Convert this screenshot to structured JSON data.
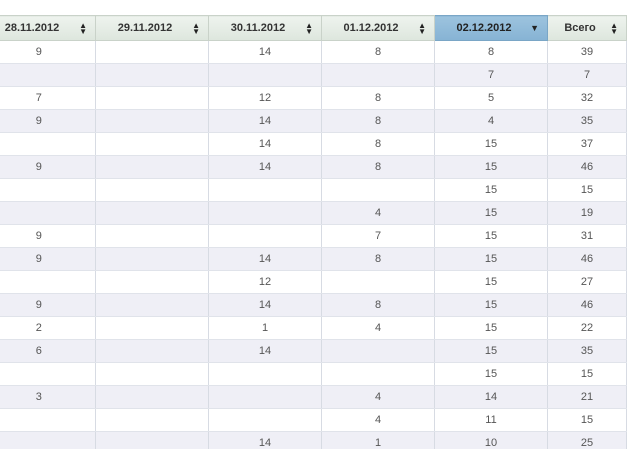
{
  "columns": [
    {
      "label": "28.11.2012",
      "sort_icon": "sort-both-icon",
      "active": false
    },
    {
      "label": "29.11.2012",
      "sort_icon": "sort-both-icon",
      "active": false
    },
    {
      "label": "30.11.2012",
      "sort_icon": "sort-both-icon",
      "active": false
    },
    {
      "label": "01.12.2012",
      "sort_icon": "sort-both-icon",
      "active": false
    },
    {
      "label": "02.12.2012",
      "sort_icon": "sort-desc-icon",
      "active": true
    },
    {
      "label": "Всего",
      "sort_icon": "sort-both-icon",
      "active": false
    }
  ],
  "colors": {
    "active_header": "#8ab6d6",
    "header": "#e4ebe4",
    "alt_row": "#efeff6"
  },
  "rows": [
    [
      "9",
      "",
      "14",
      "8",
      "8",
      "39"
    ],
    [
      "",
      "",
      "",
      "",
      "7",
      "7"
    ],
    [
      "7",
      "",
      "12",
      "8",
      "5",
      "32"
    ],
    [
      "9",
      "",
      "14",
      "8",
      "4",
      "35"
    ],
    [
      "",
      "",
      "14",
      "8",
      "15",
      "37"
    ],
    [
      "9",
      "",
      "14",
      "8",
      "15",
      "46"
    ],
    [
      "",
      "",
      "",
      "",
      "15",
      "15"
    ],
    [
      "",
      "",
      "",
      "4",
      "15",
      "19"
    ],
    [
      "9",
      "",
      "",
      "7",
      "15",
      "31"
    ],
    [
      "9",
      "",
      "14",
      "8",
      "15",
      "46"
    ],
    [
      "",
      "",
      "12",
      "",
      "15",
      "27"
    ],
    [
      "9",
      "",
      "14",
      "8",
      "15",
      "46"
    ],
    [
      "2",
      "",
      "1",
      "4",
      "15",
      "22"
    ],
    [
      "6",
      "",
      "14",
      "",
      "15",
      "35"
    ],
    [
      "",
      "",
      "",
      "",
      "15",
      "15"
    ],
    [
      "3",
      "",
      "",
      "4",
      "14",
      "21"
    ],
    [
      "",
      "",
      "",
      "4",
      "11",
      "15"
    ],
    [
      "",
      "",
      "14",
      "1",
      "10",
      "25"
    ]
  ]
}
